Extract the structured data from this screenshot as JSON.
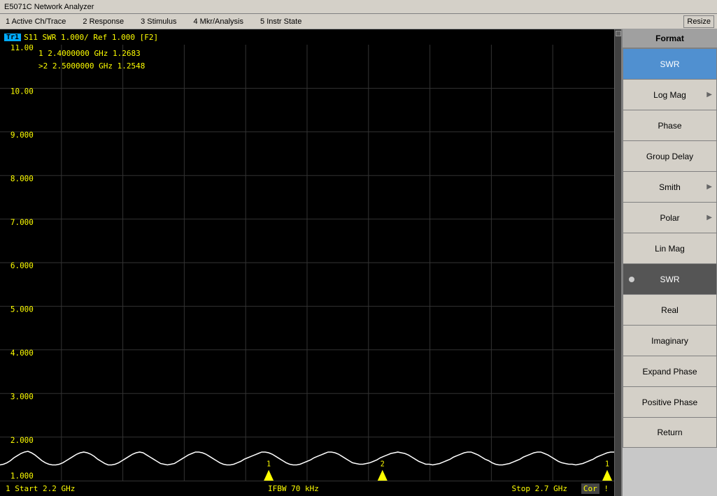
{
  "titleBar": {
    "title": "E5071C Network Analyzer"
  },
  "menuBar": {
    "items": [
      "1 Active Ch/Trace",
      "2 Response",
      "3 Stimulus",
      "4 Mkr/Analysis",
      "5 Instr State"
    ],
    "resizeBtn": "Resize"
  },
  "chartHeader": {
    "traceLabel": "Tr1",
    "info": "S11  SWR  1.000/  Ref  1.000  [F2]"
  },
  "markerInfo": {
    "marker1": "1   2.4000000 GHz   1.2683",
    "marker2": ">2  2.5000000 GHz   1.2548"
  },
  "yAxis": {
    "labels": [
      "11.00",
      "10.00",
      "9.000",
      "8.000",
      "7.000",
      "6.000",
      "5.000",
      "4.000",
      "3.000",
      "2.000",
      "1.000"
    ]
  },
  "footer": {
    "startLabel": "1  Start  2.2 GHz",
    "centerLabel": "IFBW  70 kHz",
    "stopLabel": "Stop  2.7 GHz",
    "corLabel": "Cor",
    "warningLabel": "!"
  },
  "rightPanel": {
    "formatLabel": "Format",
    "buttons": [
      {
        "id": "swr-top",
        "label": "SWR",
        "state": "format-active"
      },
      {
        "id": "log-mag",
        "label": "Log Mag",
        "arrow": true
      },
      {
        "id": "phase",
        "label": "Phase",
        "arrow": false
      },
      {
        "id": "group-delay",
        "label": "Group Delay",
        "arrow": false
      },
      {
        "id": "smith",
        "label": "Smith",
        "arrow": true
      },
      {
        "id": "polar",
        "label": "Polar",
        "arrow": true
      },
      {
        "id": "lin-mag",
        "label": "Lin Mag",
        "arrow": false
      },
      {
        "id": "swr-btn",
        "label": "SWR",
        "selected": true,
        "dot": true
      },
      {
        "id": "real",
        "label": "Real",
        "arrow": false
      },
      {
        "id": "imaginary",
        "label": "Imaginary",
        "arrow": false
      },
      {
        "id": "expand-phase",
        "label": "Expand Phase",
        "arrow": false
      },
      {
        "id": "positive-phase",
        "label": "Positive Phase",
        "arrow": false
      },
      {
        "id": "return",
        "label": "Return",
        "arrow": false
      }
    ]
  }
}
